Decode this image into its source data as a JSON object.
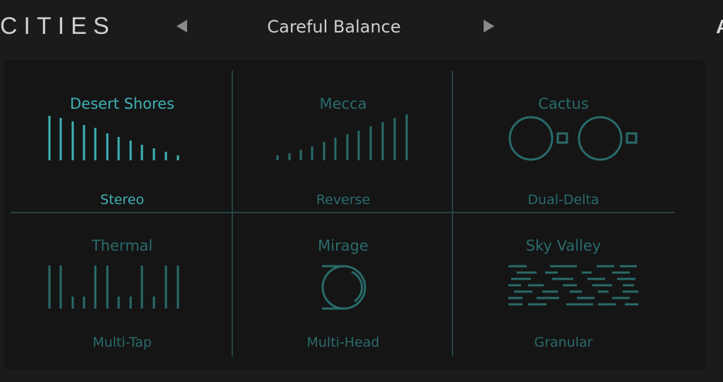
{
  "header": {
    "title": "CITIES",
    "preset": "Careful Balance",
    "right_partial": "A"
  },
  "colors": {
    "accent": "#3fb2b6",
    "dim": "#2a6b6b",
    "grid": "#234444",
    "panel": "#151515",
    "background": "#1b1b1b"
  },
  "modes": [
    {
      "name": "Desert Shores",
      "type": "Stereo",
      "selected": true,
      "icon": "descending-bars-icon"
    },
    {
      "name": "Mecca",
      "type": "Reverse",
      "selected": false,
      "icon": "ascending-bars-icon"
    },
    {
      "name": "Cactus",
      "type": "Dual-Delta",
      "selected": false,
      "icon": "dual-circle-icon"
    },
    {
      "name": "Thermal",
      "type": "Multi-Tap",
      "selected": false,
      "icon": "multitap-bars-icon"
    },
    {
      "name": "Mirage",
      "type": "Multi-Head",
      "selected": false,
      "icon": "tape-head-icon"
    },
    {
      "name": "Sky Valley",
      "type": "Granular",
      "selected": false,
      "icon": "granular-dashes-icon"
    }
  ]
}
